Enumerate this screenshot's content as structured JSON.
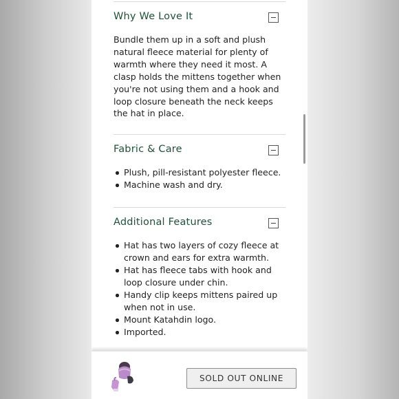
{
  "sections": {
    "why_we_love_it": {
      "title": "Why We Love It",
      "lines": [
        "Bundle them up in a soft and plush",
        "natural fleece material for plenty of",
        "warmth where they need it most. A",
        "clasp holds the mittens together when",
        "you're not using them and a hook and",
        "loop closure beneath the neck keeps",
        "the hat in place."
      ]
    },
    "fabric_care": {
      "title": "Fabric & Care",
      "items": [
        "Plush, pill-resistant polyester fleece.",
        "Machine wash and dry."
      ]
    },
    "additional_features": {
      "title": "Additional Features",
      "items": [
        [
          "Hat has two layers of cozy fleece at",
          "crown and ears for extra warmth."
        ],
        [
          "Hat has fleece tabs with hook and",
          "loop closure under chin."
        ],
        [
          "Handy clip keeps mittens paired up",
          "when not in use."
        ],
        [
          "Mount Katahdin logo."
        ],
        [
          "Imported."
        ]
      ]
    }
  },
  "toggle_icon": "minus-icon",
  "footer": {
    "cta_label": "SOLD OUT ONLINE",
    "thumbnail_icon": "product-thumbnail"
  },
  "colors": {
    "heading": "#1f5238",
    "body_text": "#222222",
    "divider": "#d9d9d9",
    "button_bg": "#efefef",
    "button_border": "#8c8c8c"
  }
}
